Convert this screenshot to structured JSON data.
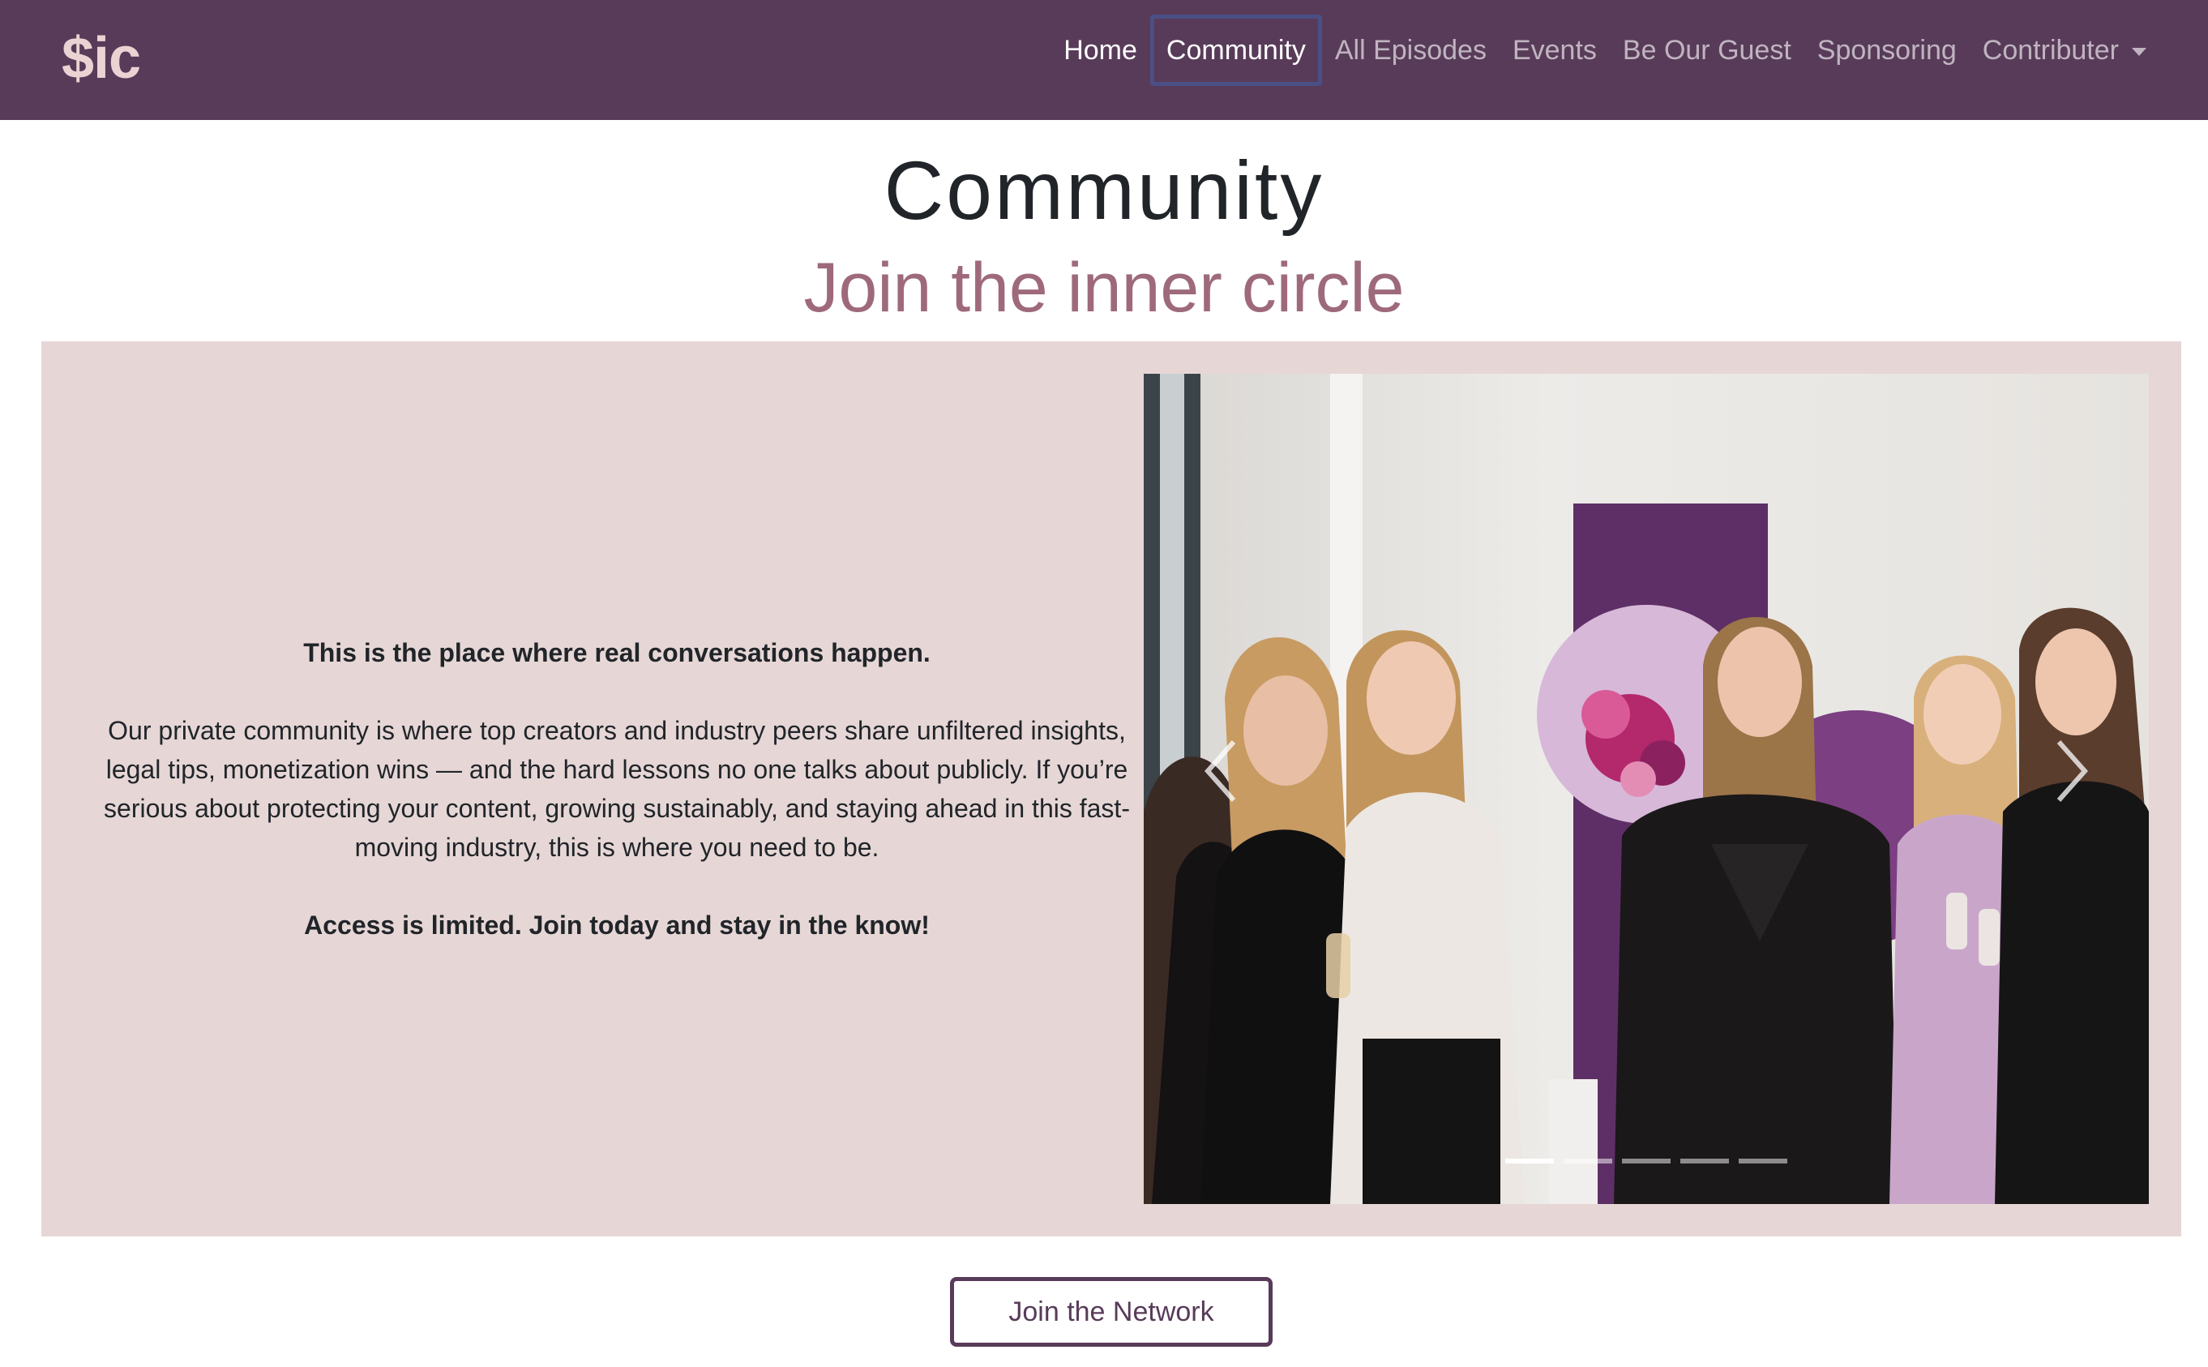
{
  "brand": {
    "logo_text": "$ic"
  },
  "nav": {
    "items": [
      {
        "label": "Home"
      },
      {
        "label": "Community"
      },
      {
        "label": "All Episodes"
      },
      {
        "label": "Events"
      },
      {
        "label": "Be Our Guest"
      },
      {
        "label": "Sponsoring"
      },
      {
        "label": "Contributer"
      }
    ],
    "active_index": 0,
    "current_index": 1
  },
  "page": {
    "title": "Community",
    "subtitle": "Join the inner circle"
  },
  "intro": {
    "headline": "This is the place where real conversations happen.",
    "body": "Our private community is where top creators and industry peers share unfiltered insights, legal tips, monetization wins — and the hard lessons no one talks about publicly. If you’re serious about protecting your content, growing sustainably, and staying ahead in this fast-moving industry, this is where you need to be.",
    "closing": "Access is limited. Join today and stay in the know!"
  },
  "carousel": {
    "slide_count": 5,
    "active_slide": 1
  },
  "cta": {
    "label": "Join the Network"
  },
  "colors": {
    "navbar": "#583b59",
    "brand": "#ead3d3",
    "subtitle": "#9e6a7b",
    "panel": "#e6d7d6",
    "button_border": "#583b59"
  }
}
